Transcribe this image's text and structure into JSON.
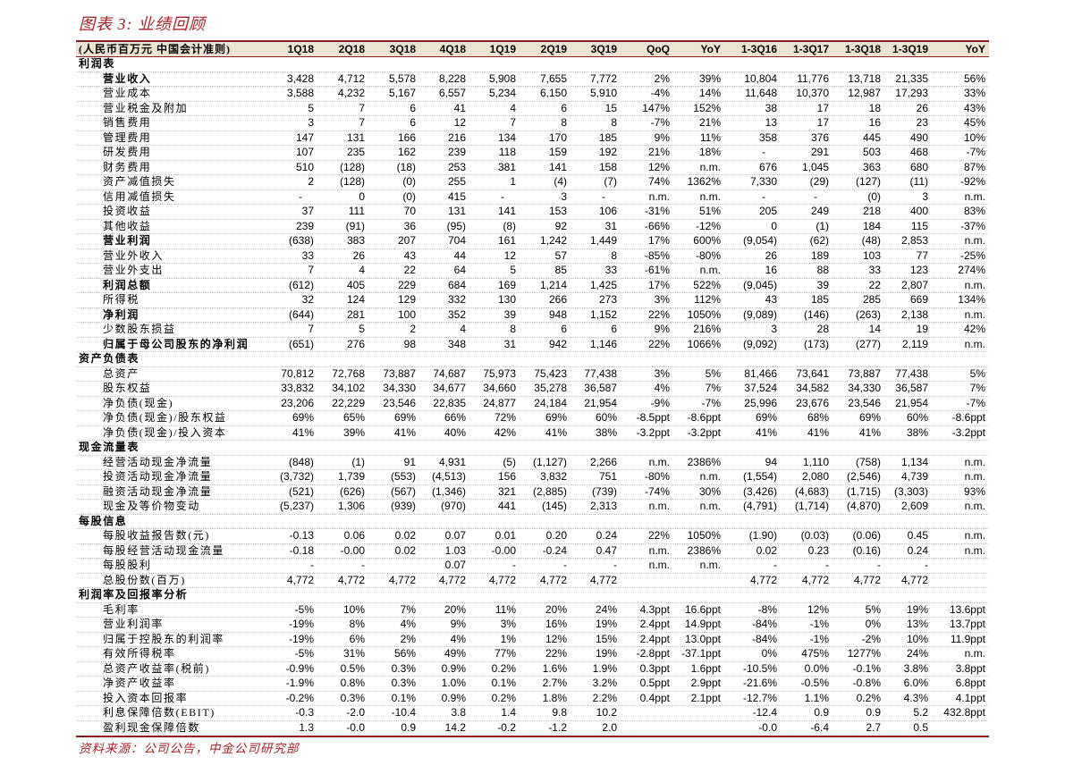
{
  "title": "图表 3: 业绩回顾",
  "colors": {
    "title_text": "#a8232a",
    "header_background": "#ede3d3",
    "rules": "#8c1d1d"
  },
  "table": {
    "header_label": "(人民币百万元 中国会计准则)",
    "columns": [
      "1Q18",
      "2Q18",
      "3Q18",
      "4Q18",
      "1Q19",
      "2Q19",
      "3Q19",
      "QoQ",
      "YoY",
      "1-3Q16",
      "1-3Q17",
      "1-3Q18",
      "1-3Q19",
      "YoY"
    ],
    "sections": [
      {
        "name": "利润表",
        "rows": [
          {
            "label": "营业收入",
            "bold": true,
            "values": [
              "3,428",
              "4,712",
              "5,578",
              "8,228",
              "5,908",
              "7,655",
              "7,772",
              "2%",
              "39%",
              "10,804",
              "11,776",
              "13,718",
              "21,335",
              "56%"
            ]
          },
          {
            "label": "营业成本",
            "values": [
              "3,588",
              "4,232",
              "5,167",
              "6,557",
              "5,234",
              "6,150",
              "5,910",
              "-4%",
              "14%",
              "11,648",
              "10,370",
              "12,987",
              "17,293",
              "33%"
            ]
          },
          {
            "label": "营业税金及附加",
            "values": [
              "5",
              "7",
              "6",
              "41",
              "4",
              "6",
              "15",
              "147%",
              "152%",
              "38",
              "17",
              "18",
              "26",
              "43%"
            ]
          },
          {
            "label": "销售费用",
            "values": [
              "3",
              "7",
              "6",
              "12",
              "7",
              "8",
              "8",
              "-7%",
              "21%",
              "13",
              "17",
              "16",
              "23",
              "45%"
            ]
          },
          {
            "label": "管理费用",
            "values": [
              "147",
              "131",
              "166",
              "216",
              "134",
              "170",
              "185",
              "9%",
              "11%",
              "358",
              "376",
              "445",
              "490",
              "10%"
            ]
          },
          {
            "label": "研发费用",
            "values": [
              "107",
              "235",
              "162",
              "239",
              "118",
              "159",
              "192",
              "21%",
              "18%",
              "-",
              "291",
              "503",
              "468",
              "-7%"
            ]
          },
          {
            "label": "财务费用",
            "values": [
              "510",
              "(128)",
              "(18)",
              "253",
              "381",
              "141",
              "158",
              "12%",
              "n.m.",
              "676",
              "1,045",
              "363",
              "680",
              "87%"
            ]
          },
          {
            "label": "资产减值损失",
            "values": [
              "2",
              "(128)",
              "(0)",
              "255",
              "1",
              "(4)",
              "(7)",
              "74%",
              "1362%",
              "7,330",
              "(29)",
              "(127)",
              "(11)",
              "-92%"
            ]
          },
          {
            "label": "信用减值损失",
            "values": [
              "-",
              "0",
              "(0)",
              "415",
              "-",
              "3",
              "-",
              "n.m.",
              "n.m.",
              "-",
              "-",
              "(0)",
              "3",
              "n.m."
            ]
          },
          {
            "label": "投资收益",
            "values": [
              "37",
              "111",
              "70",
              "131",
              "141",
              "153",
              "106",
              "-31%",
              "51%",
              "205",
              "249",
              "218",
              "400",
              "83%"
            ]
          },
          {
            "label": "其他收益",
            "values": [
              "239",
              "(91)",
              "36",
              "(95)",
              "(8)",
              "92",
              "31",
              "-66%",
              "-12%",
              "0",
              "(1)",
              "184",
              "115",
              "-37%"
            ]
          },
          {
            "label": "营业利润",
            "bold": true,
            "values": [
              "(638)",
              "383",
              "207",
              "704",
              "161",
              "1,242",
              "1,449",
              "17%",
              "600%",
              "(9,054)",
              "(62)",
              "(48)",
              "2,853",
              "n.m."
            ]
          },
          {
            "label": "营业外收入",
            "values": [
              "33",
              "26",
              "43",
              "44",
              "12",
              "57",
              "8",
              "-85%",
              "-80%",
              "26",
              "189",
              "103",
              "77",
              "-25%"
            ]
          },
          {
            "label": "营业外支出",
            "values": [
              "7",
              "4",
              "22",
              "64",
              "5",
              "85",
              "33",
              "-61%",
              "n.m.",
              "16",
              "88",
              "33",
              "123",
              "274%"
            ]
          },
          {
            "label": "利润总额",
            "bold": true,
            "values": [
              "(612)",
              "405",
              "229",
              "684",
              "169",
              "1,214",
              "1,425",
              "17%",
              "522%",
              "(9,045)",
              "39",
              "22",
              "2,807",
              "n.m."
            ]
          },
          {
            "label": "所得税",
            "values": [
              "32",
              "124",
              "129",
              "332",
              "130",
              "266",
              "273",
              "3%",
              "112%",
              "43",
              "185",
              "285",
              "669",
              "134%"
            ]
          },
          {
            "label": "净利润",
            "bold": true,
            "values": [
              "(644)",
              "281",
              "100",
              "352",
              "39",
              "948",
              "1,152",
              "22%",
              "1050%",
              "(9,089)",
              "(146)",
              "(263)",
              "2,138",
              "n.m."
            ]
          },
          {
            "label": "少数股东损益",
            "values": [
              "7",
              "5",
              "2",
              "4",
              "8",
              "6",
              "6",
              "9%",
              "216%",
              "3",
              "28",
              "14",
              "19",
              "42%"
            ]
          },
          {
            "label": "归属于母公司股东的净利润",
            "bold": true,
            "values": [
              "(651)",
              "276",
              "98",
              "348",
              "31",
              "942",
              "1,146",
              "22%",
              "1066%",
              "(9,092)",
              "(173)",
              "(277)",
              "2,119",
              "n.m."
            ]
          }
        ]
      },
      {
        "name": "资产负债表",
        "rows": [
          {
            "label": "总资产",
            "values": [
              "70,812",
              "72,768",
              "73,887",
              "74,687",
              "75,973",
              "75,423",
              "77,438",
              "3%",
              "5%",
              "81,466",
              "73,641",
              "73,887",
              "77,438",
              "5%"
            ]
          },
          {
            "label": "股东权益",
            "values": [
              "33,832",
              "34,102",
              "34,330",
              "34,677",
              "34,660",
              "35,278",
              "36,587",
              "4%",
              "7%",
              "37,524",
              "34,582",
              "34,330",
              "36,587",
              "7%"
            ]
          },
          {
            "label": "净负债(现金)",
            "values": [
              "23,206",
              "22,229",
              "23,546",
              "22,835",
              "24,877",
              "24,184",
              "21,954",
              "-9%",
              "-7%",
              "25,996",
              "23,676",
              "23,546",
              "21,954",
              "-7%"
            ]
          },
          {
            "label": "净负债(现金)/股东权益",
            "values": [
              "69%",
              "65%",
              "69%",
              "66%",
              "72%",
              "69%",
              "60%",
              "-8.5ppt",
              "-8.6ppt",
              "69%",
              "68%",
              "69%",
              "60%",
              "-8.6ppt"
            ]
          },
          {
            "label": "净负债(现金)/投入资本",
            "values": [
              "41%",
              "39%",
              "41%",
              "40%",
              "42%",
              "41%",
              "38%",
              "-3.2ppt",
              "-3.2ppt",
              "41%",
              "41%",
              "41%",
              "38%",
              "-3.2ppt"
            ]
          }
        ]
      },
      {
        "name": "现金流量表",
        "rows": [
          {
            "label": "经营活动现金净流量",
            "values": [
              "(848)",
              "(1)",
              "91",
              "4,931",
              "(5)",
              "(1,127)",
              "2,266",
              "n.m.",
              "2386%",
              "94",
              "1,110",
              "(758)",
              "1,134",
              "n.m."
            ]
          },
          {
            "label": "投资活动现金净流量",
            "values": [
              "(3,732)",
              "1,739",
              "(553)",
              "(4,513)",
              "156",
              "3,832",
              "751",
              "-80%",
              "n.m.",
              "(1,554)",
              "2,080",
              "(2,546)",
              "4,739",
              "n.m."
            ]
          },
          {
            "label": "融资活动现金净流量",
            "values": [
              "(521)",
              "(626)",
              "(567)",
              "(1,346)",
              "321",
              "(2,885)",
              "(739)",
              "-74%",
              "30%",
              "(3,426)",
              "(4,683)",
              "(1,715)",
              "(3,303)",
              "93%"
            ]
          },
          {
            "label": "现金及等价物变动",
            "values": [
              "(5,237)",
              "1,306",
              "(939)",
              "(970)",
              "441",
              "(145)",
              "2,313",
              "n.m.",
              "n.m.",
              "(4,791)",
              "(1,714)",
              "(4,870)",
              "2,609",
              "n.m."
            ]
          }
        ]
      },
      {
        "name": "每股信息",
        "rows": [
          {
            "label": "每股收益报告数(元)",
            "values": [
              "-0.13",
              "0.06",
              "0.02",
              "0.07",
              "0.01",
              "0.20",
              "0.24",
              "22%",
              "1050%",
              "(1.90)",
              "(0.03)",
              "(0.06)",
              "0.45",
              "n.m."
            ]
          },
          {
            "label": "每股经营活动现金流量",
            "values": [
              "-0.18",
              "-0.00",
              "0.02",
              "1.03",
              "-0.00",
              "-0.24",
              "0.47",
              "n.m.",
              "2386%",
              "0.02",
              "0.23",
              "(0.16)",
              "0.24",
              "n.m."
            ]
          },
          {
            "label": "每股股利",
            "values": [
              "-",
              "-",
              "",
              "0.07",
              "-",
              "-",
              "-",
              "n.m.",
              "n.m.",
              "-",
              "-",
              "-",
              "-",
              ""
            ]
          },
          {
            "label": "总股份数(百万)",
            "values": [
              "4,772",
              "4,772",
              "4,772",
              "4,772",
              "4,772",
              "4,772",
              "4,772",
              "",
              "",
              "4,772",
              "4,772",
              "4,772",
              "4,772",
              ""
            ]
          }
        ]
      },
      {
        "name": "利润率及回报率分析",
        "rows": [
          {
            "label": "毛利率",
            "values": [
              "-5%",
              "10%",
              "7%",
              "20%",
              "11%",
              "20%",
              "24%",
              "4.3ppt",
              "16.6ppt",
              "-8%",
              "12%",
              "5%",
              "19%",
              "13.6ppt"
            ]
          },
          {
            "label": "营业利润率",
            "values": [
              "-19%",
              "8%",
              "4%",
              "9%",
              "3%",
              "16%",
              "19%",
              "2.4ppt",
              "14.9ppt",
              "-84%",
              "-1%",
              "0%",
              "13%",
              "13.7ppt"
            ]
          },
          {
            "label": "归属于控股东的利润率",
            "values": [
              "-19%",
              "6%",
              "2%",
              "4%",
              "1%",
              "12%",
              "15%",
              "2.4ppt",
              "13.0ppt",
              "-84%",
              "-1%",
              "-2%",
              "10%",
              "11.9ppt"
            ]
          },
          {
            "label": "有效所得税率",
            "values": [
              "-5%",
              "31%",
              "56%",
              "49%",
              "77%",
              "22%",
              "19%",
              "-2.8ppt",
              "-37.1ppt",
              "0%",
              "475%",
              "1277%",
              "24%",
              "n.m."
            ]
          },
          {
            "label": "总资产收益率(税前)",
            "values": [
              "-0.9%",
              "0.5%",
              "0.3%",
              "0.9%",
              "0.2%",
              "1.6%",
              "1.9%",
              "0.3ppt",
              "1.6ppt",
              "-10.5%",
              "0.0%",
              "-0.1%",
              "3.8%",
              "3.8ppt"
            ]
          },
          {
            "label": "净资产收益率",
            "values": [
              "-1.9%",
              "0.8%",
              "0.3%",
              "1.0%",
              "0.1%",
              "2.7%",
              "3.2%",
              "0.5ppt",
              "2.9ppt",
              "-21.6%",
              "-0.5%",
              "-0.8%",
              "6.0%",
              "6.8ppt"
            ]
          },
          {
            "label": "投入资本回报率",
            "values": [
              "-0.2%",
              "0.3%",
              "0.1%",
              "0.9%",
              "0.2%",
              "1.8%",
              "2.2%",
              "0.4ppt",
              "2.1ppt",
              "-12.7%",
              "1.1%",
              "0.2%",
              "4.3%",
              "4.1ppt"
            ]
          },
          {
            "label": "利息保障倍数(EBIT)",
            "values": [
              "-0.3",
              "-2.0",
              "-10.4",
              "3.8",
              "1.4",
              "9.8",
              "10.2",
              "",
              "",
              "-12.4",
              "0.9",
              "0.9",
              "5.2",
              "432.8ppt"
            ]
          },
          {
            "label": "盈利现金保障倍数",
            "values": [
              "1.3",
              "-0.0",
              "0.9",
              "14.2",
              "-0.2",
              "-1.2",
              "2.0",
              "",
              "",
              "-0.0",
              "-6.4",
              "2.7",
              "0.5",
              ""
            ]
          }
        ]
      }
    ]
  },
  "source": "资料来源：公司公告，中金公司研究部"
}
